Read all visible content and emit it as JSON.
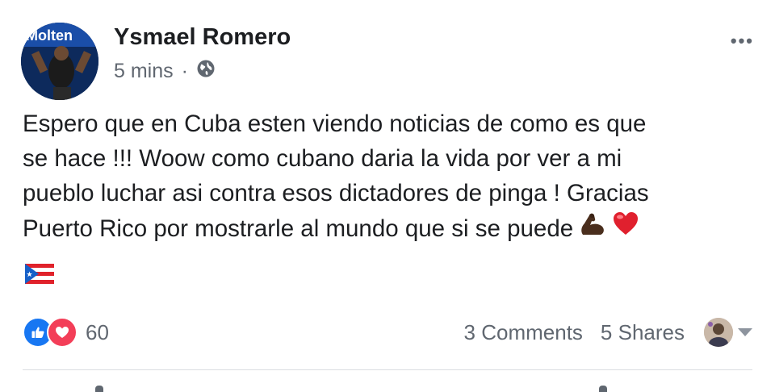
{
  "post": {
    "author": "Ysmael Romero",
    "time": "5 mins",
    "separator": "·",
    "privacy_icon": "globe-icon",
    "more_icon": "ellipsis-icon",
    "more_label": "•••",
    "text_lines": [
      "Espero que en Cuba esten viendo noticias  de como es que",
      "se hace !!! Woow como cubano daria la vida por ver a mi",
      "pueblo luchar asi contra esos dictadores de pinga ! Gracias",
      "Puerto Rico por mostrarle al mundo que si se puede"
    ],
    "emojis": [
      "flexed-biceps-icon",
      "red-heart-icon",
      "puerto-rico-flag-icon"
    ]
  },
  "stats": {
    "reaction_icons": [
      "like-reaction-icon",
      "love-reaction-icon"
    ],
    "reaction_count": "60",
    "comments": "3 Comments",
    "shares": "5 Shares"
  },
  "colors": {
    "text": "#1c1e21",
    "secondary": "#606770",
    "like_blue": "#1877f2",
    "love_red": "#f33e58",
    "divider": "#dadde1"
  }
}
